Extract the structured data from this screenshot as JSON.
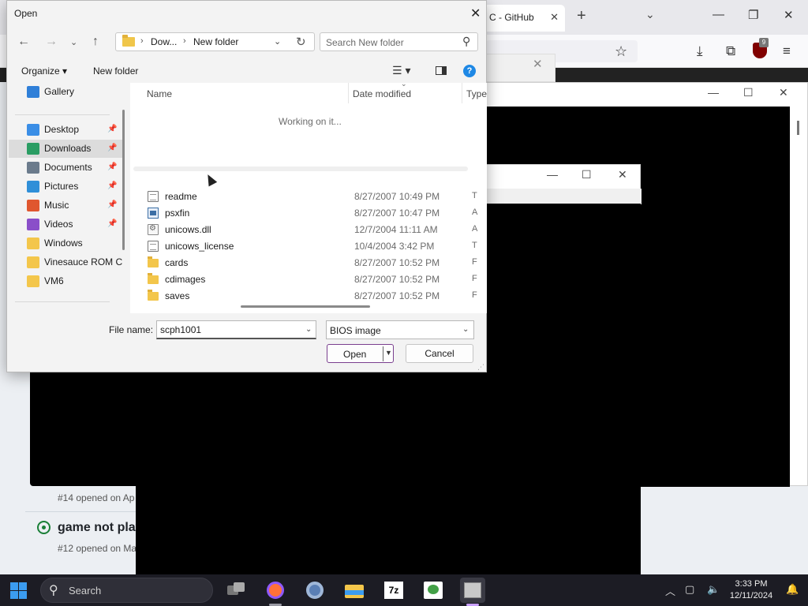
{
  "browser": {
    "tab_title": "C - GitHub",
    "issues": {
      "issue_a_meta": "#14 opened on Ap",
      "issue_b_title": "game not play",
      "issue_b_meta": "#12 opened on Ma"
    }
  },
  "dialog": {
    "title": "Open",
    "address": {
      "crumb1": "Dow...",
      "crumb2": "New folder"
    },
    "search_placeholder": "Search New folder",
    "toolbar": {
      "organize": "Organize",
      "new_folder": "New folder"
    },
    "nav_items": [
      {
        "label": "Gallery",
        "icon": "gallery-icon",
        "color": "#2f7fd8",
        "pinned": false
      },
      {
        "label": "Desktop",
        "icon": "desktop-icon",
        "color": "#3a8ee6",
        "pinned": true
      },
      {
        "label": "Downloads",
        "icon": "downloads-icon",
        "color": "#2a9d63",
        "pinned": true,
        "selected": true
      },
      {
        "label": "Documents",
        "icon": "documents-icon",
        "color": "#6b7b8c",
        "pinned": true
      },
      {
        "label": "Pictures",
        "icon": "pictures-icon",
        "color": "#2f8fd8",
        "pinned": true
      },
      {
        "label": "Music",
        "icon": "music-icon",
        "color": "#e0572f",
        "pinned": true
      },
      {
        "label": "Videos",
        "icon": "videos-icon",
        "color": "#8a4fc9",
        "pinned": true
      },
      {
        "label": "Windows",
        "icon": "folder-icon",
        "color": "#f3c64b",
        "pinned": false
      },
      {
        "label": "Vinesauce ROM C",
        "icon": "folder-icon",
        "color": "#f3c64b",
        "pinned": false
      },
      {
        "label": "VM6",
        "icon": "folder-icon",
        "color": "#f3c64b",
        "pinned": false
      }
    ],
    "columns": {
      "name": "Name",
      "date": "Date modified",
      "type": "Type"
    },
    "status_text": "Working on it...",
    "files": [
      {
        "name": "readme",
        "date": "8/27/2007 10:49 PM",
        "kind": "txt",
        "type": "T"
      },
      {
        "name": "psxfin",
        "date": "8/27/2007 10:47 PM",
        "kind": "exe",
        "type": "A"
      },
      {
        "name": "unicows.dll",
        "date": "12/7/2004 11:11 AM",
        "kind": "dll",
        "type": "A"
      },
      {
        "name": "unicows_license",
        "date": "10/4/2004 3:42 PM",
        "kind": "txt",
        "type": "T"
      },
      {
        "name": "cards",
        "date": "8/27/2007 10:52 PM",
        "kind": "folder",
        "type": "F"
      },
      {
        "name": "cdimages",
        "date": "8/27/2007 10:52 PM",
        "kind": "folder",
        "type": "F"
      },
      {
        "name": "saves",
        "date": "8/27/2007 10:52 PM",
        "kind": "folder",
        "type": "F"
      }
    ],
    "filename_label": "File name:",
    "filename_value": "scph1001",
    "filetype_value": "BIOS image",
    "open_label": "Open",
    "cancel_label": "Cancel"
  },
  "taskbar": {
    "search_label": "Search",
    "time": "3:33 PM",
    "date": "12/11/2024"
  }
}
